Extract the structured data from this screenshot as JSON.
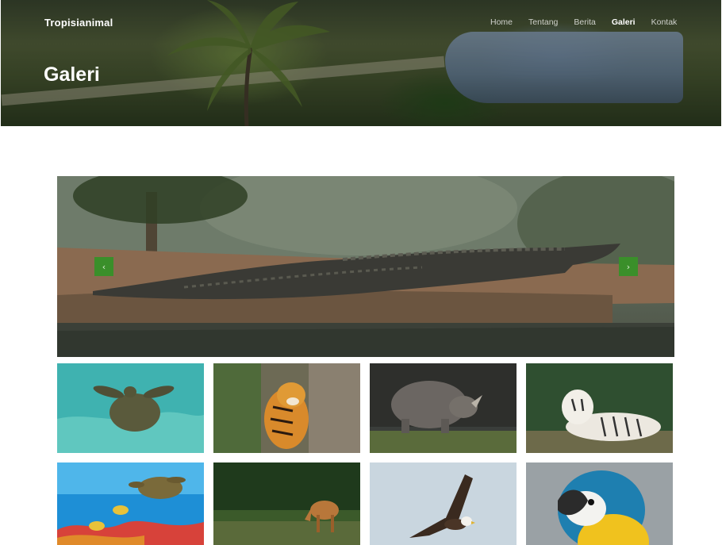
{
  "header": {
    "brand": "Tropisianimal",
    "page_title": "Galeri",
    "nav": [
      {
        "label": "Home",
        "active": false
      },
      {
        "label": "Tentang",
        "active": false
      },
      {
        "label": "Berita",
        "active": false
      },
      {
        "label": "Galeri",
        "active": true
      },
      {
        "label": "Kontak",
        "active": false
      }
    ]
  },
  "slider": {
    "prev_icon": "chevron-left-icon",
    "next_icon": "chevron-right-icon",
    "prev_glyph": "‹",
    "next_glyph": "›",
    "accent": "#3a8f2a"
  },
  "gallery": {
    "images": [
      "sea-turtle-image",
      "tiger-image",
      "rhino-image",
      "white-tiger-image",
      "turtle-reef-image",
      "deer-image",
      "eagle-image",
      "macaw-image"
    ]
  }
}
